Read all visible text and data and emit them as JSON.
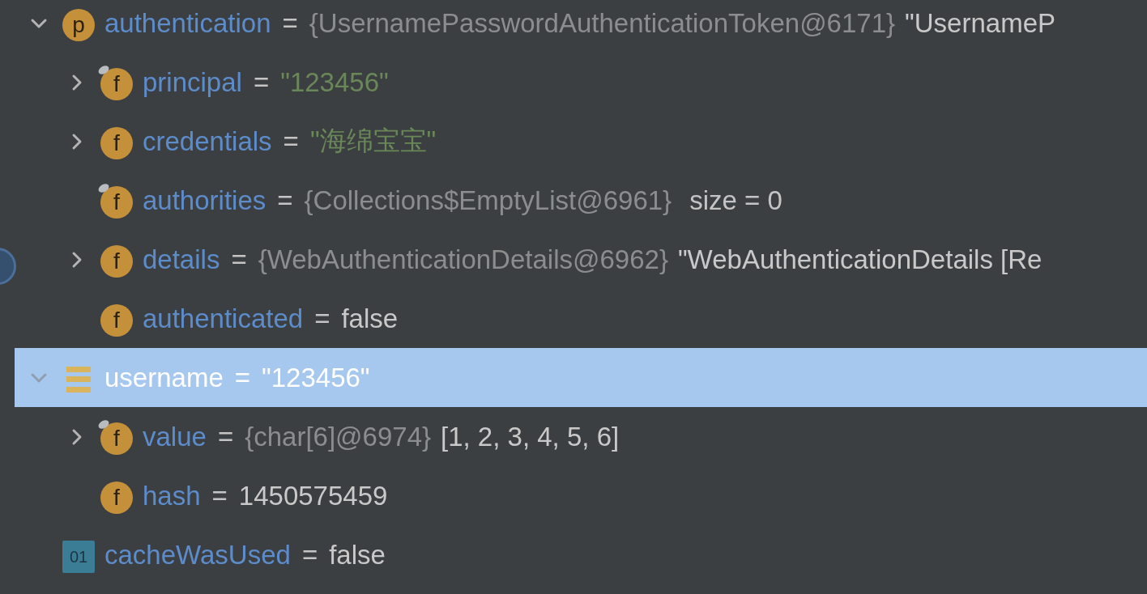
{
  "variables": [
    {
      "name": "authentication",
      "separator": "=",
      "ref": "{UsernamePasswordAuthenticationToken@6171}",
      "value": "\"UsernameP",
      "quoted_string": false,
      "expanded": true,
      "selected": false,
      "icon": {
        "kind": "letter",
        "letter": "p",
        "decorated": false
      },
      "children": [
        {
          "name": "principal",
          "separator": "=",
          "value": "\"123456\"",
          "quoted_string": true,
          "expanded": false,
          "selected": false,
          "icon": {
            "kind": "letter",
            "letter": "f",
            "decorated": true
          }
        },
        {
          "name": "credentials",
          "separator": "=",
          "value": "\"海绵宝宝\"",
          "quoted_string": true,
          "expanded": false,
          "selected": false,
          "icon": {
            "kind": "letter",
            "letter": "f",
            "decorated": false
          }
        },
        {
          "name": "authorities",
          "separator": "=",
          "ref": "{Collections$EmptyList@6961}",
          "extra": "size = 0",
          "selected": false,
          "icon": {
            "kind": "letter",
            "letter": "f",
            "decorated": true
          }
        },
        {
          "name": "details",
          "separator": "=",
          "ref": "{WebAuthenticationDetails@6962}",
          "value": "\"WebAuthenticationDetails [Re",
          "quoted_string": false,
          "expanded": false,
          "selected": false,
          "icon": {
            "kind": "letter",
            "letter": "f",
            "decorated": false
          }
        },
        {
          "name": "authenticated",
          "separator": "=",
          "value": "false",
          "quoted_string": false,
          "selected": false,
          "icon": {
            "kind": "letter",
            "letter": "f",
            "decorated": false
          }
        }
      ]
    },
    {
      "name": "username",
      "separator": "=",
      "value": "\"123456\"",
      "quoted_string": true,
      "expanded": true,
      "selected": true,
      "icon": {
        "kind": "local",
        "decorated": false
      },
      "children": [
        {
          "name": "value",
          "separator": "=",
          "ref": "{char[6]@6974}",
          "value": "[1, 2, 3, 4, 5, 6]",
          "quoted_string": false,
          "expanded": false,
          "selected": false,
          "icon": {
            "kind": "letter",
            "letter": "f",
            "decorated": true
          }
        },
        {
          "name": "hash",
          "separator": "=",
          "value": "1450575459",
          "quoted_string": false,
          "selected": false,
          "icon": {
            "kind": "letter",
            "letter": "f",
            "decorated": false
          }
        }
      ]
    },
    {
      "name": "cacheWasUsed",
      "separator": "=",
      "value": "false",
      "quoted_string": false,
      "selected": false,
      "icon": {
        "kind": "primitive",
        "letter": "01",
        "decorated": false
      }
    }
  ]
}
